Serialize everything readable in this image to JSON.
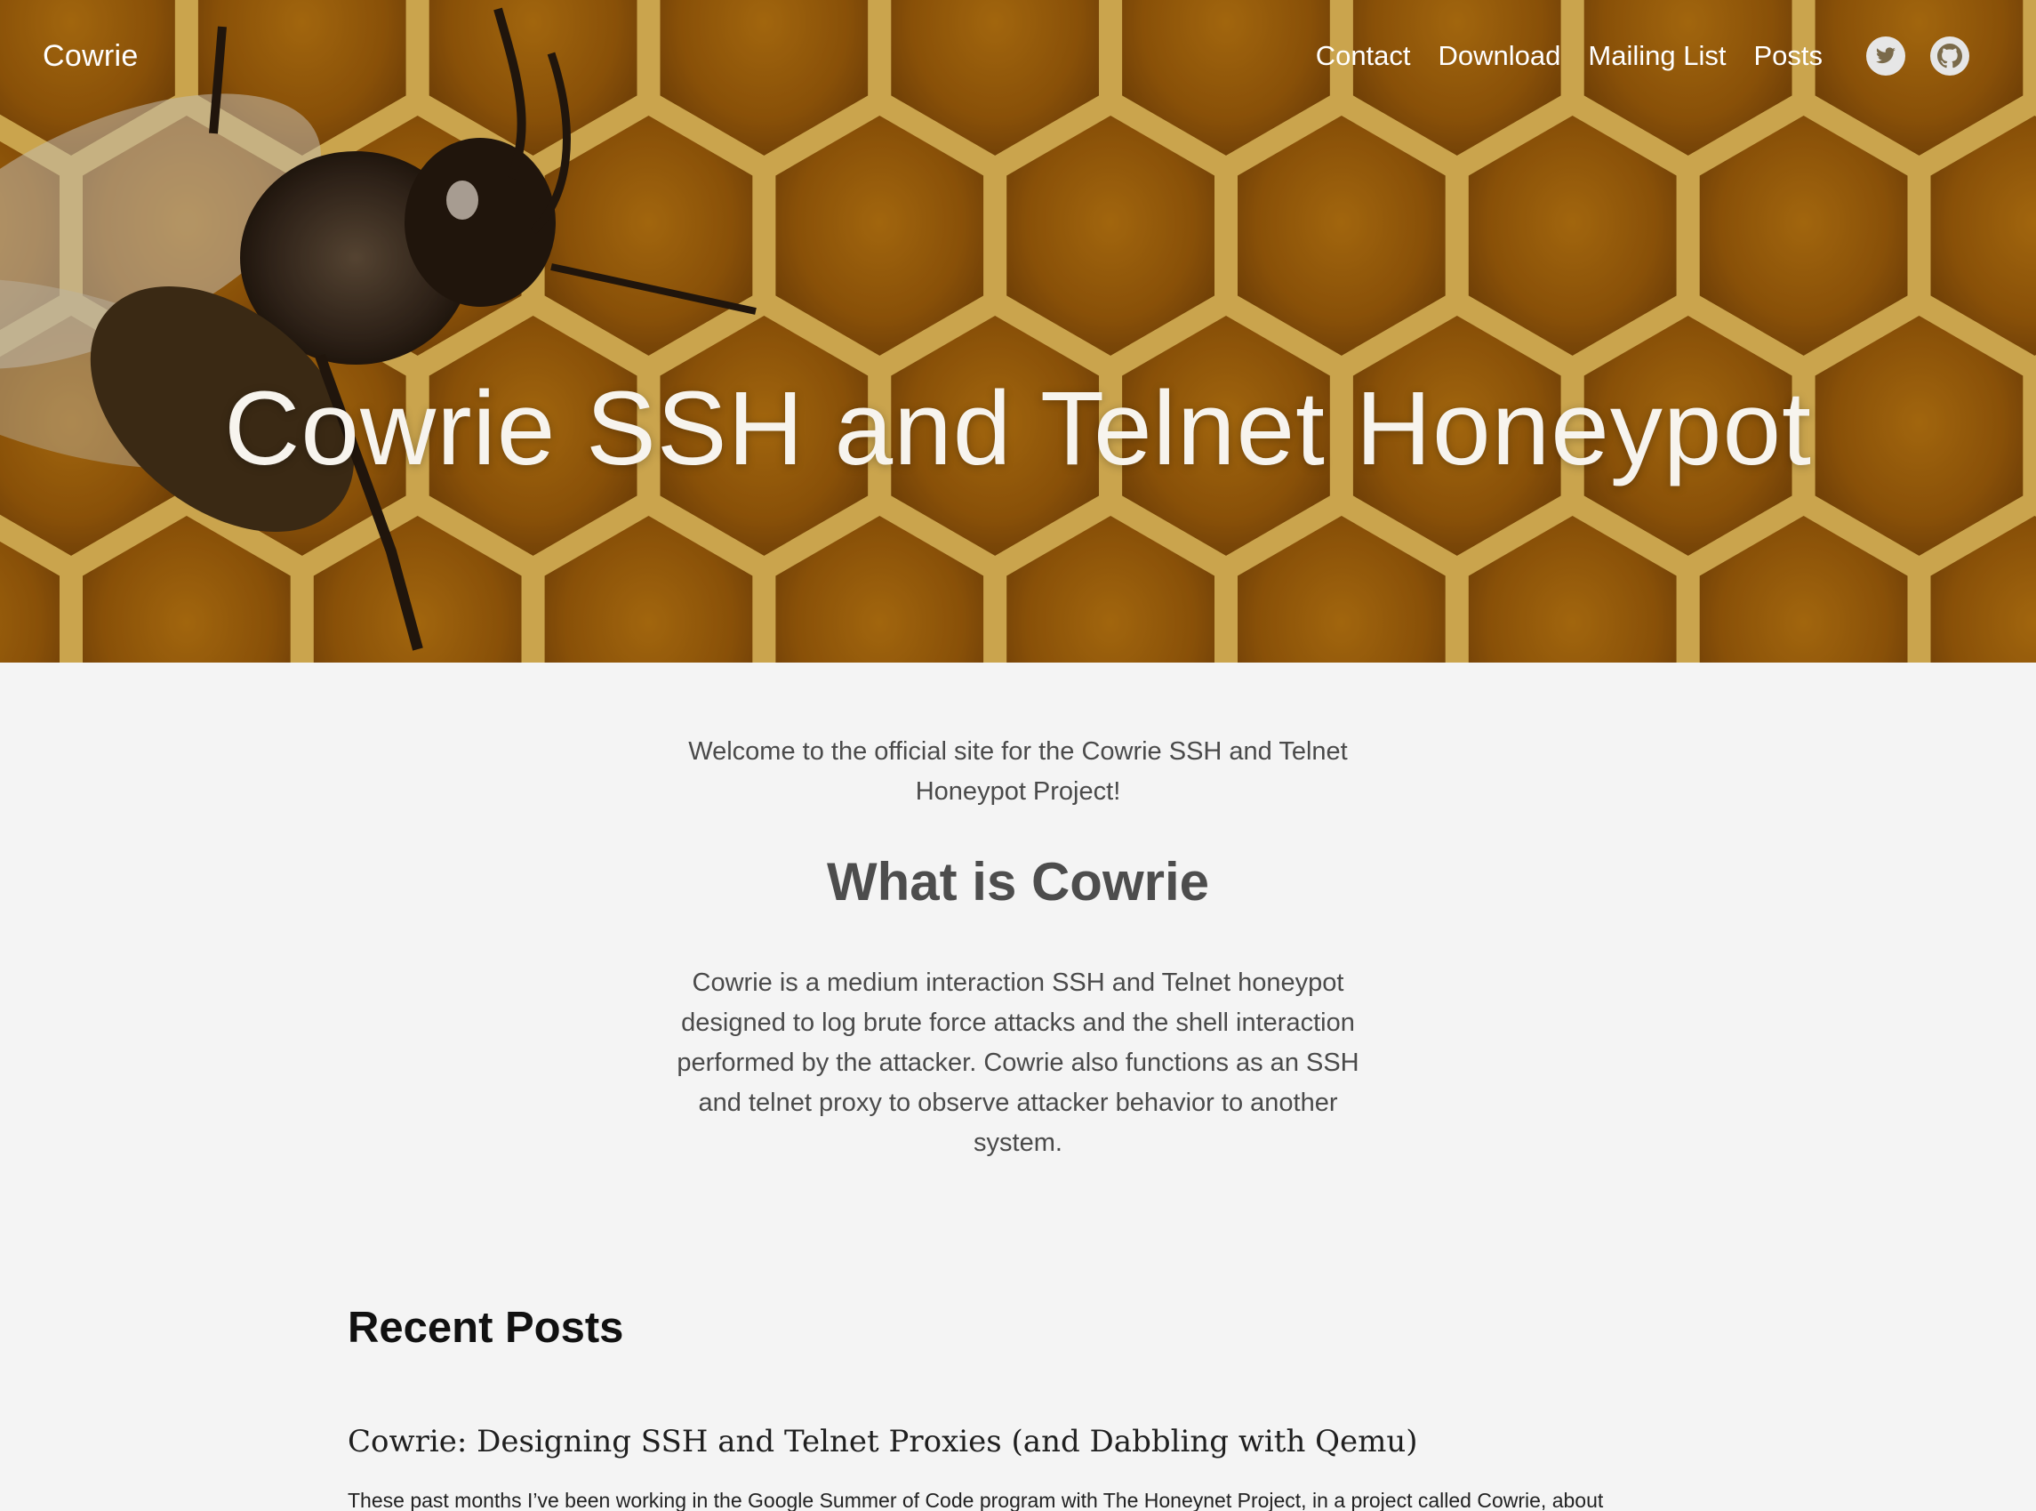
{
  "nav": {
    "brand": "Cowrie",
    "links": [
      "Contact",
      "Download",
      "Mailing List",
      "Posts"
    ],
    "social": [
      "twitter-icon",
      "github-icon"
    ]
  },
  "hero": {
    "title": "Cowrie SSH and Telnet Honeypot"
  },
  "main": {
    "intro": "Welcome to the official site for the Cowrie SSH and Telnet Honeypot Project!",
    "heading": "What is Cowrie",
    "description": "Cowrie is a medium interaction SSH and Telnet honeypot designed to log brute force attacks and the shell interaction performed by the attacker. Cowrie also functions as an SSH and telnet proxy to observe attacker behavior to another system."
  },
  "recent": {
    "heading": "Recent Posts",
    "posts": [
      {
        "title": "Cowrie: Designing SSH and Telnet Proxies (and Dabbling with Qemu)",
        "excerpt": "These past months I’ve been working in the Google Summer of Code program with The Honeynet Project, in a project called Cowrie, about"
      }
    ]
  },
  "colors": {
    "page_background": "#f4f4f4",
    "honey": "#c8860f",
    "text_muted": "#4a4a4a"
  }
}
